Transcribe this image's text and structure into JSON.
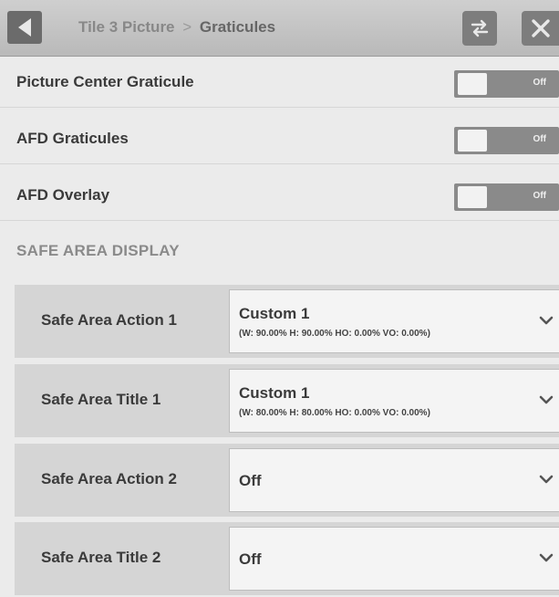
{
  "header": {
    "breadcrumb_parent": "Tile 3 Picture",
    "breadcrumb_separator": ">",
    "breadcrumb_current": "Graticules"
  },
  "toggles": [
    {
      "label": "Picture Center Graticule",
      "state": "Off"
    },
    {
      "label": "AFD Graticules",
      "state": "Off"
    },
    {
      "label": "AFD Overlay",
      "state": "Off"
    }
  ],
  "safe_area": {
    "section_title": "SAFE AREA DISPLAY",
    "items": [
      {
        "label": "Safe Area Action 1",
        "value": "Custom 1",
        "detail": "(W: 90.00% H: 90.00% HO: 0.00% VO: 0.00%)"
      },
      {
        "label": "Safe Area Title 1",
        "value": "Custom 1",
        "detail": "(W: 80.00% H: 80.00% HO: 0.00% VO: 0.00%)"
      },
      {
        "label": "Safe Area Action 2",
        "value": "Off",
        "detail": ""
      },
      {
        "label": "Safe Area Title 2",
        "value": "Off",
        "detail": ""
      }
    ]
  },
  "icons": {
    "back": "back-arrow-icon",
    "swap": "swap-icon",
    "close": "close-icon",
    "dropdown": "chevron-down-icon"
  },
  "colors": {
    "header_bg": "#c4c4c4",
    "toggle_track": "#8a8a8a",
    "page_bg": "#ebebeb",
    "dropdown_bg": "#f4f4f4"
  }
}
